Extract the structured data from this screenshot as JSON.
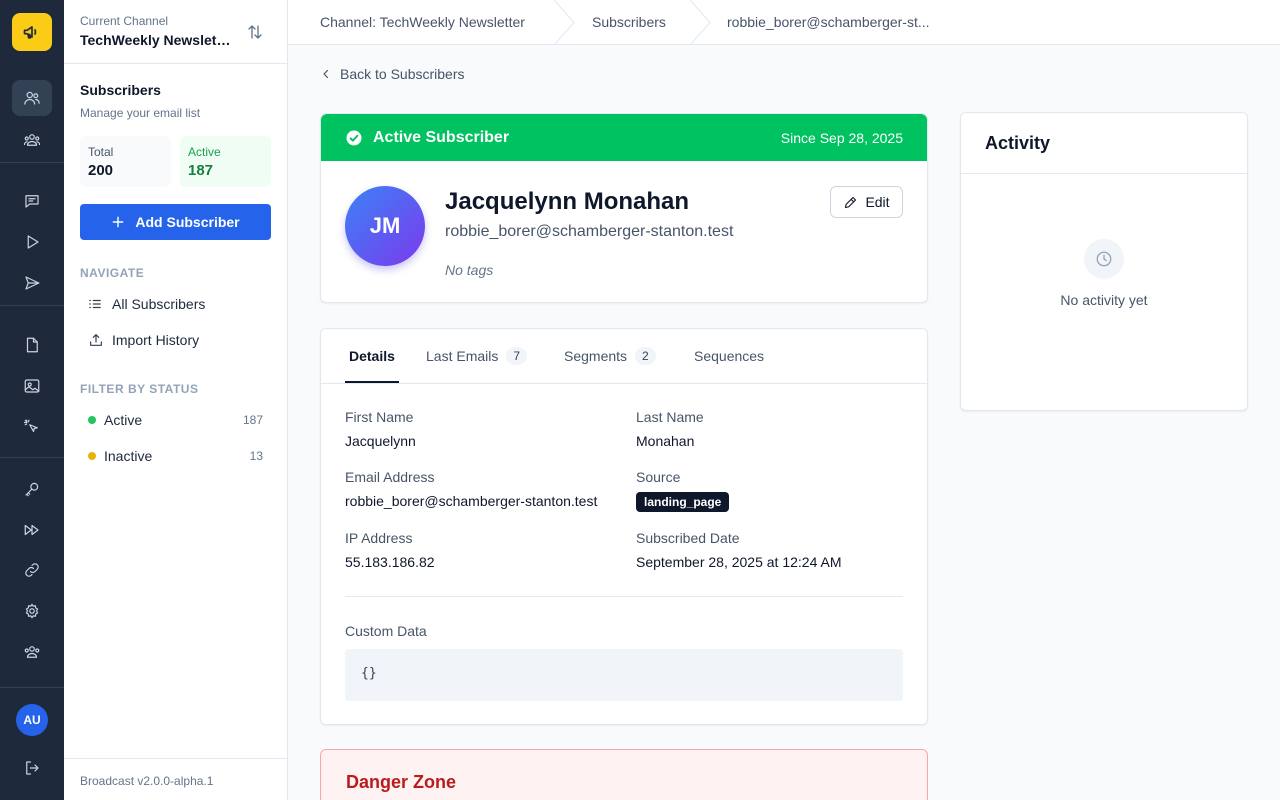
{
  "rail": {
    "icons": [
      "megaphone-icon",
      "subscribers-icon",
      "segments-icon",
      "messages-icon",
      "sequences-icon",
      "broadcasts-icon",
      "templates-icon",
      "images-icon",
      "tracking-icon",
      "api-keys-icon",
      "webhooks-icon",
      "links-icon",
      "settings-icon",
      "team-icon"
    ],
    "user_initials": "AU"
  },
  "sidebar": {
    "channel_label": "Current Channel",
    "channel_name": "TechWeekly Newsletter",
    "section_title": "Subscribers",
    "section_subtitle": "Manage your email list",
    "stats": {
      "total_label": "Total",
      "total_value": "200",
      "active_label": "Active",
      "active_value": "187"
    },
    "add_button": "Add Subscriber",
    "navigate_heading": "NAVIGATE",
    "nav": [
      {
        "label": "All Subscribers"
      },
      {
        "label": "Import History"
      }
    ],
    "filter_heading": "FILTER BY STATUS",
    "filters": [
      {
        "label": "Active",
        "count": "187",
        "color": "#22c55e"
      },
      {
        "label": "Inactive",
        "count": "13",
        "color": "#eab308"
      }
    ],
    "version": "Broadcast v2.0.0-alpha.1"
  },
  "breadcrumb": [
    "Channel: TechWeekly Newsletter",
    "Subscribers",
    "robbie_borer@schamberger-st..."
  ],
  "back_link": "Back to Subscribers",
  "profile": {
    "status": "Active Subscriber",
    "since": "Since Sep 28, 2025",
    "initials": "JM",
    "name": "Jacquelynn Monahan",
    "email": "robbie_borer@schamberger-stanton.test",
    "tags": "No tags",
    "edit_label": "Edit"
  },
  "tabs": [
    {
      "label": "Details"
    },
    {
      "label": "Last Emails",
      "count": "7"
    },
    {
      "label": "Segments",
      "count": "2"
    },
    {
      "label": "Sequences"
    }
  ],
  "details": {
    "first_name_label": "First Name",
    "first_name": "Jacquelynn",
    "last_name_label": "Last Name",
    "last_name": "Monahan",
    "email_label": "Email Address",
    "email": "robbie_borer@schamberger-stanton.test",
    "source_label": "Source",
    "source": "landing_page",
    "ip_label": "IP Address",
    "ip": "55.183.186.82",
    "subscribed_label": "Subscribed Date",
    "subscribed": "September 28, 2025 at 12:24 AM",
    "custom_label": "Custom Data",
    "custom": "{}"
  },
  "activity": {
    "title": "Activity",
    "empty": "No activity yet"
  },
  "danger_zone": {
    "title": "Danger Zone"
  },
  "colors": {
    "brand": "#2563eb",
    "success": "#00c260",
    "rail": "#1e293b",
    "logo": "#facc15",
    "danger": "#b91c1c"
  }
}
